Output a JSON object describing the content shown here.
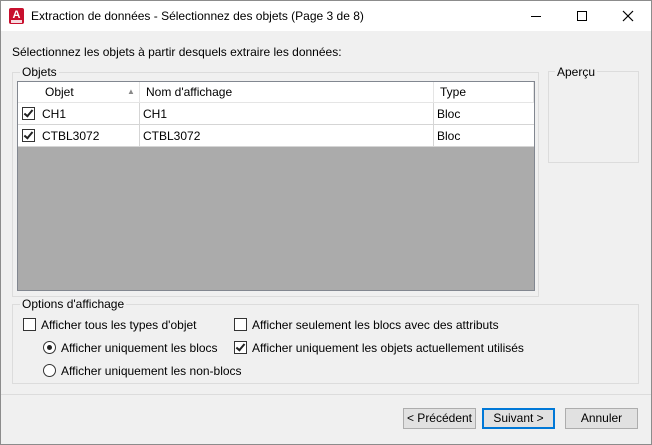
{
  "window": {
    "title": "Extraction de données - Sélectionnez des objets (Page 3 de 8)",
    "app_icon_letter": "A"
  },
  "instruction": "Sélectionnez les objets à partir desquels extraire les données:",
  "objects_group": {
    "label": "Objets",
    "columns": [
      "Objet",
      "Nom d'affichage",
      "Type"
    ],
    "rows": [
      {
        "checked": true,
        "objet": "CH1",
        "nom": "CH1",
        "type": "Bloc"
      },
      {
        "checked": true,
        "objet": "CTBL3072",
        "nom": "CTBL3072",
        "type": "Bloc"
      }
    ],
    "sort_column": "Objet",
    "sort_direction": "ascending"
  },
  "preview_group": {
    "label": "Aperçu"
  },
  "display_options": {
    "label": "Options d'affichage",
    "show_all_types": {
      "label": "Afficher tous les types d'objet",
      "checked": false
    },
    "blocks_only": {
      "label": "Afficher uniquement les blocs",
      "selected": true
    },
    "non_blocks_only": {
      "label": "Afficher uniquement les non-blocs",
      "selected": false
    },
    "blocks_with_attributes": {
      "label": "Afficher seulement les  blocs avec des attributs",
      "checked": false
    },
    "in_use_only": {
      "label": "Afficher uniquement les objets actuellement utilisés",
      "checked": true
    }
  },
  "buttons": {
    "previous": "< Précédent",
    "next": "Suivant >",
    "cancel": "Annuler"
  },
  "colors": {
    "accent": "#0078d7",
    "app_icon": "#c8102e",
    "list_empty_area": "#ababab"
  }
}
